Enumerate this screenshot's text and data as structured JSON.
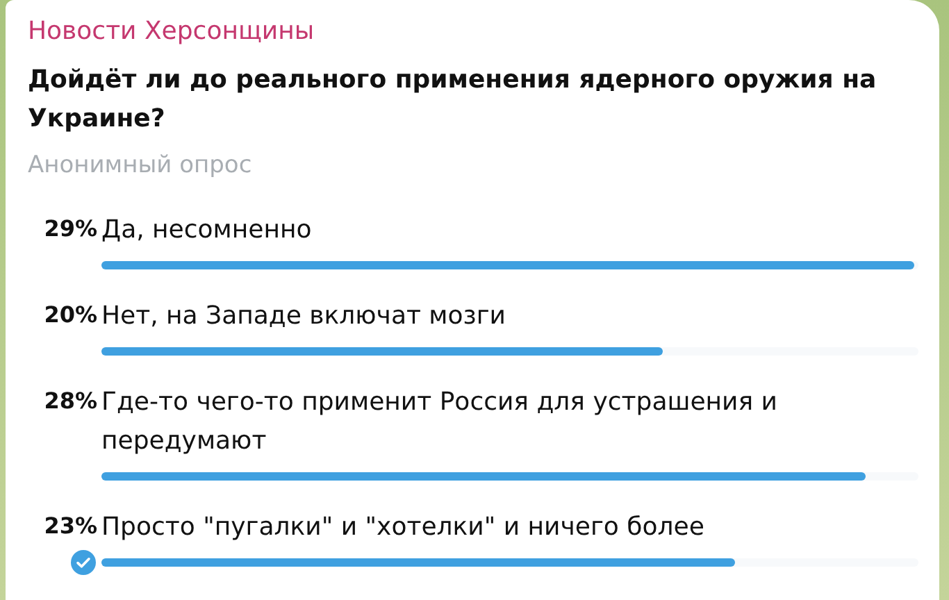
{
  "channel": {
    "name": "Новости Херсонщины"
  },
  "poll": {
    "question": "Дойдёт ли до реального применения ядерного оружия на Украине?",
    "type_label": "Анонимный опрос",
    "options": [
      {
        "percent": "29%",
        "text": "Да, несомненно",
        "level": 1.0,
        "selected": false
      },
      {
        "percent": "20%",
        "text": "Нет, на Западе включат мозги",
        "level": 0.69,
        "selected": false
      },
      {
        "percent": "28%",
        "text": "Где-то чего-то применит Россия для устрашения и передумают",
        "level": 0.94,
        "selected": false
      },
      {
        "percent": "23%",
        "text": "Просто \"пугалки\" и \"хотелки\" и ничего более",
        "level": 0.78,
        "selected": true
      }
    ]
  }
}
